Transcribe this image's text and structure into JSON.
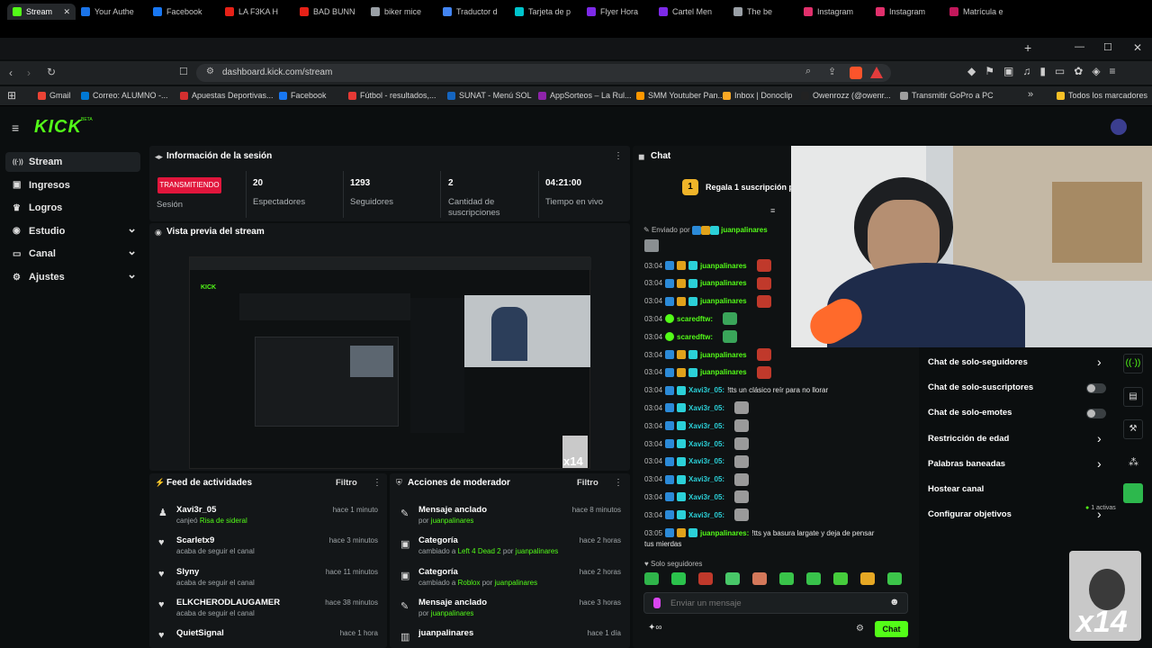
{
  "tabs": [
    {
      "label": "Stream",
      "color": "#53fc18",
      "active": true
    },
    {
      "label": "Your Authe",
      "color": "#1a73e8"
    },
    {
      "label": "Facebook",
      "color": "#1877f2"
    },
    {
      "label": "LA F3KA H",
      "color": "#e62117"
    },
    {
      "label": "BAD BUNN",
      "color": "#e62117"
    },
    {
      "label": "biker mice",
      "color": "#9aa0a6"
    },
    {
      "label": "Traductor d",
      "color": "#4285f4"
    },
    {
      "label": "Tarjeta de p",
      "color": "#00c4cc"
    },
    {
      "label": "Flyer Hora",
      "color": "#7d2ae8"
    },
    {
      "label": "Cartel Men",
      "color": "#7d2ae8"
    },
    {
      "label": "The be",
      "color": "#9aa0a6"
    },
    {
      "label": "Instagram",
      "color": "#e1306c"
    },
    {
      "label": "Instagram",
      "color": "#e1306c"
    },
    {
      "label": "Matrícula e",
      "color": "#c2185b"
    }
  ],
  "address": "dashboard.kick.com/stream",
  "bookmarks": [
    {
      "label": "Gmail",
      "color": "#ea4335"
    },
    {
      "label": "Correo: ALUMNO -...",
      "color": "#0078d4"
    },
    {
      "label": "Apuestas Deportivas...",
      "color": "#d32f2f"
    },
    {
      "label": "Facebook",
      "color": "#1877f2"
    },
    {
      "label": "Fútbol - resultados,...",
      "color": "#e53935"
    },
    {
      "label": "SUNAT - Menú SOL",
      "color": "#1565c0"
    },
    {
      "label": "AppSorteos – La Rul...",
      "color": "#8e24aa"
    },
    {
      "label": "SMM Youtuber Pan...",
      "color": "#ff9800"
    },
    {
      "label": "Inbox | Donoclip",
      "color": "#f9a825"
    },
    {
      "label": "Owenrozz (@owenr...",
      "color": "#222222"
    },
    {
      "label": "Transmitir GoPro a PC",
      "color": "#9e9e9e"
    },
    {
      "label": "Todos los marcadores",
      "color": "#f6c026"
    }
  ],
  "brand": {
    "logo": "KICK",
    "beta": "BETA",
    "accent": "#53fc18"
  },
  "nav": [
    {
      "label": "Stream",
      "icon": "broadcast-icon",
      "active": true
    },
    {
      "label": "Ingresos",
      "icon": "money-icon"
    },
    {
      "label": "Logros",
      "icon": "trophy-icon"
    },
    {
      "label": "Estudio",
      "icon": "studio-icon",
      "expand": true
    },
    {
      "label": "Canal",
      "icon": "channel-icon",
      "expand": true
    },
    {
      "label": "Ajustes",
      "icon": "gear-icon",
      "expand": true
    }
  ],
  "session": {
    "title": "Información de la sesión",
    "live_badge": "TRANSMITIENDO",
    "session_label": "Sesión",
    "stats": [
      {
        "value": "20",
        "label": "Espectadores"
      },
      {
        "value": "1293",
        "label": "Seguidores"
      },
      {
        "value": "2",
        "label": "Cantidad de suscripciones"
      },
      {
        "value": "04:21:00",
        "label": "Tiempo en vivo"
      }
    ]
  },
  "preview": {
    "title": "Vista previa del stream",
    "overlay": "x14"
  },
  "feed": {
    "title": "Feed de actividades",
    "filter": "Filtro",
    "items": [
      {
        "name": "Xavi3r_05",
        "sub": "canjeó",
        "highlight": "Risa de sideral",
        "time": "hace 1 minuto"
      },
      {
        "name": "Scarletx9",
        "sub": "acaba de seguir el canal",
        "time": "hace 3 minutos"
      },
      {
        "name": "Slyny",
        "sub": "acaba de seguir el canal",
        "time": "hace 11 minutos"
      },
      {
        "name": "ELKCHERODLAUGAMER",
        "sub": "acaba de seguir el canal",
        "time": "hace 38 minutos"
      },
      {
        "name": "QuietSignal",
        "sub": "",
        "time": "hace 1 hora"
      }
    ]
  },
  "mod": {
    "title": "Acciones de moderador",
    "filter": "Filtro",
    "items": [
      {
        "name": "Mensaje anclado",
        "sub": "por",
        "user": "juanpalinares",
        "time": "hace 8 minutos"
      },
      {
        "name": "Categoría",
        "sub": "cambiado a",
        "cat": "Left 4 Dead 2",
        "sub2": "por",
        "user": "juanpalinares",
        "time": "hace 2 horas"
      },
      {
        "name": "Categoría",
        "sub": "cambiado a",
        "cat": "Roblox",
        "sub2": "por",
        "user": "juanpalinares",
        "time": "hace 2 horas"
      },
      {
        "name": "Mensaje anclado",
        "sub": "por",
        "user": "juanpalinares",
        "time": "hace 3 horas"
      },
      {
        "name": "juanpalinares",
        "sub": "",
        "time": "hace 1 día"
      }
    ]
  },
  "chat": {
    "title": "Chat",
    "gift_text": "Regala 1 suscripción pa",
    "pinned_label": "Enviado por",
    "pinned_user": "juanpalinares",
    "messages": [
      {
        "time": "03:04",
        "user": "juanpalinares",
        "color": "#53fc18",
        "text": ""
      },
      {
        "time": "03:04",
        "user": "juanpalinares",
        "color": "#53fc18",
        "text": ""
      },
      {
        "time": "03:04",
        "user": "juanpalinares",
        "color": "#53fc18",
        "text": ""
      },
      {
        "time": "03:04",
        "user": "scaredftw:",
        "color": "#53fc18",
        "text": ""
      },
      {
        "time": "03:04",
        "user": "scaredftw:",
        "color": "#53fc18",
        "text": ""
      },
      {
        "time": "03:04",
        "user": "juanpalinares",
        "color": "#53fc18",
        "text": ""
      },
      {
        "time": "03:04",
        "user": "juanpalinares",
        "color": "#53fc18",
        "text": ""
      },
      {
        "time": "03:04",
        "user": "Xavi3r_05:",
        "color": "#2bd0d8",
        "text": "!tts un clásico reír para no llorar"
      },
      {
        "time": "03:04",
        "user": "Xavi3r_05:",
        "color": "#2bd0d8",
        "text": ""
      },
      {
        "time": "03:04",
        "user": "Xavi3r_05:",
        "color": "#2bd0d8",
        "text": ""
      },
      {
        "time": "03:04",
        "user": "Xavi3r_05:",
        "color": "#2bd0d8",
        "text": ""
      },
      {
        "time": "03:04",
        "user": "Xavi3r_05:",
        "color": "#2bd0d8",
        "text": ""
      },
      {
        "time": "03:04",
        "user": "Xavi3r_05:",
        "color": "#2bd0d8",
        "text": ""
      },
      {
        "time": "03:04",
        "user": "Xavi3r_05:",
        "color": "#2bd0d8",
        "text": ""
      },
      {
        "time": "03:04",
        "user": "Xavi3r_05:",
        "color": "#2bd0d8",
        "text": ""
      },
      {
        "time": "03:05",
        "user": "juanpalinares:",
        "color": "#53fc18",
        "text": "!tts ya basura largate y deja de pensar"
      }
    ],
    "last_line": "tus mierdas",
    "followers_only": "Solo seguidores",
    "placeholder": "Enviar un mensaje",
    "send": "Chat",
    "infinity": "∞"
  },
  "mod_menu": [
    {
      "label": "Chat de solo-seguidores",
      "type": "chevron"
    },
    {
      "label": "Chat de solo-suscriptores",
      "type": "toggle"
    },
    {
      "label": "Chat de solo-emotes",
      "type": "toggle"
    },
    {
      "label": "Restricción de edad",
      "type": "chevron"
    },
    {
      "label": "Palabras baneadas",
      "type": "chevron"
    },
    {
      "label": "Hostear canal",
      "type": "none"
    },
    {
      "label": "Configurar objetivos",
      "type": "chevron",
      "extra": "1 activas"
    }
  ],
  "overlay_corner": "x14"
}
